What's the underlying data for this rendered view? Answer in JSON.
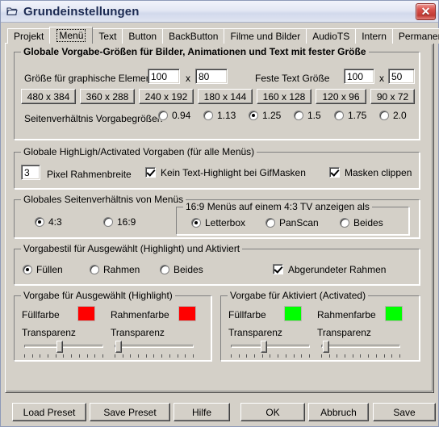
{
  "window": {
    "title": "Grundeinstellungen",
    "icon": "folder-icon",
    "close_label": "✕"
  },
  "tabs": [
    {
      "label": "Projekt",
      "active": false
    },
    {
      "label": "Menü",
      "active": true
    },
    {
      "label": "Text",
      "active": false
    },
    {
      "label": "Button",
      "active": false
    },
    {
      "label": "BackButton",
      "active": false
    },
    {
      "label": "Filme und Bilder",
      "active": false
    },
    {
      "label": "AudioTS",
      "active": false
    },
    {
      "label": "Intern",
      "active": false
    },
    {
      "label": "Permanent",
      "active": false
    }
  ],
  "sizes_group": {
    "legend": "Globale Vorgabe-Größen für Bilder, Animationen und Text mit fester Größe",
    "graphic_label": "Größe für graphische Elemente",
    "graphic_width": "100",
    "graphic_sep": "x",
    "graphic_height": "80",
    "text_label": "Feste Text Größe",
    "text_width": "100",
    "text_sep": "x",
    "text_height": "50",
    "presets": [
      "480 x 384",
      "360 x 288",
      "240 x 192",
      "180 x 144",
      "160 x 128",
      "120 x 96",
      "90 x 72"
    ],
    "ratio_label": "Seitenverhältnis Vorgabegrößen",
    "ratios": [
      {
        "label": "0.94",
        "selected": false
      },
      {
        "label": "1.13",
        "selected": false
      },
      {
        "label": "1.25",
        "selected": true
      },
      {
        "label": "1.5",
        "selected": false
      },
      {
        "label": "1.75",
        "selected": false
      },
      {
        "label": "2.0",
        "selected": false
      }
    ]
  },
  "highlight_group": {
    "legend": "Globale HighLigh/Activated Vorgaben (für alle Menüs)",
    "border_width_value": "3",
    "border_width_label": "Pixel Rahmenbreite",
    "no_text_highlight": {
      "label": "Kein Text-Highlight bei GifMasken",
      "checked": true
    },
    "clip_masks": {
      "label": "Masken clippen",
      "checked": true
    }
  },
  "aspect_group": {
    "legend": "Globales Seitenverhältnis von Menüs",
    "options": [
      {
        "label": "4:3",
        "selected": true
      },
      {
        "label": "16:9",
        "selected": false
      }
    ],
    "tv_group": {
      "legend": "16:9 Menüs auf einem 4:3 TV anzeigen als",
      "options": [
        {
          "label": "Letterbox",
          "selected": true
        },
        {
          "label": "PanScan",
          "selected": false
        },
        {
          "label": "Beides",
          "selected": false
        }
      ]
    }
  },
  "style_group": {
    "legend": "Vorgabestil für Ausgewählt (Highlight) und Aktiviert",
    "options": [
      {
        "label": "Füllen",
        "selected": true
      },
      {
        "label": "Rahmen",
        "selected": false
      },
      {
        "label": "Beides",
        "selected": false
      }
    ],
    "rounded": {
      "label": "Abgerundeter Rahmen",
      "checked": true
    }
  },
  "highlight_colors": {
    "legend": "Vorgabe für Ausgewählt (Highlight)",
    "fill_label": "Füllfarbe",
    "fill_color": "#FF0000",
    "border_label": "Rahmenfarbe",
    "border_color": "#FF0000",
    "fill_transparency_label": "Transparenz",
    "fill_transparency": 45,
    "border_transparency_label": "Transparenz",
    "border_transparency": 2,
    "tick_count": 11
  },
  "activated_colors": {
    "legend": "Vorgabe für Aktiviert (Activated)",
    "fill_label": "Füllfarbe",
    "fill_color": "#00FF00",
    "border_label": "Rahmenfarbe",
    "border_color": "#00FF00",
    "fill_transparency_label": "Transparenz",
    "fill_transparency": 42,
    "border_transparency_label": "Transparenz",
    "border_transparency": 3,
    "tick_count": 11
  },
  "footer_buttons": [
    {
      "label": "Load Preset"
    },
    {
      "label": "Save Preset"
    },
    {
      "label": "Hilfe"
    },
    {
      "label": "OK"
    },
    {
      "label": "Abbruch"
    },
    {
      "label": "Save"
    }
  ]
}
